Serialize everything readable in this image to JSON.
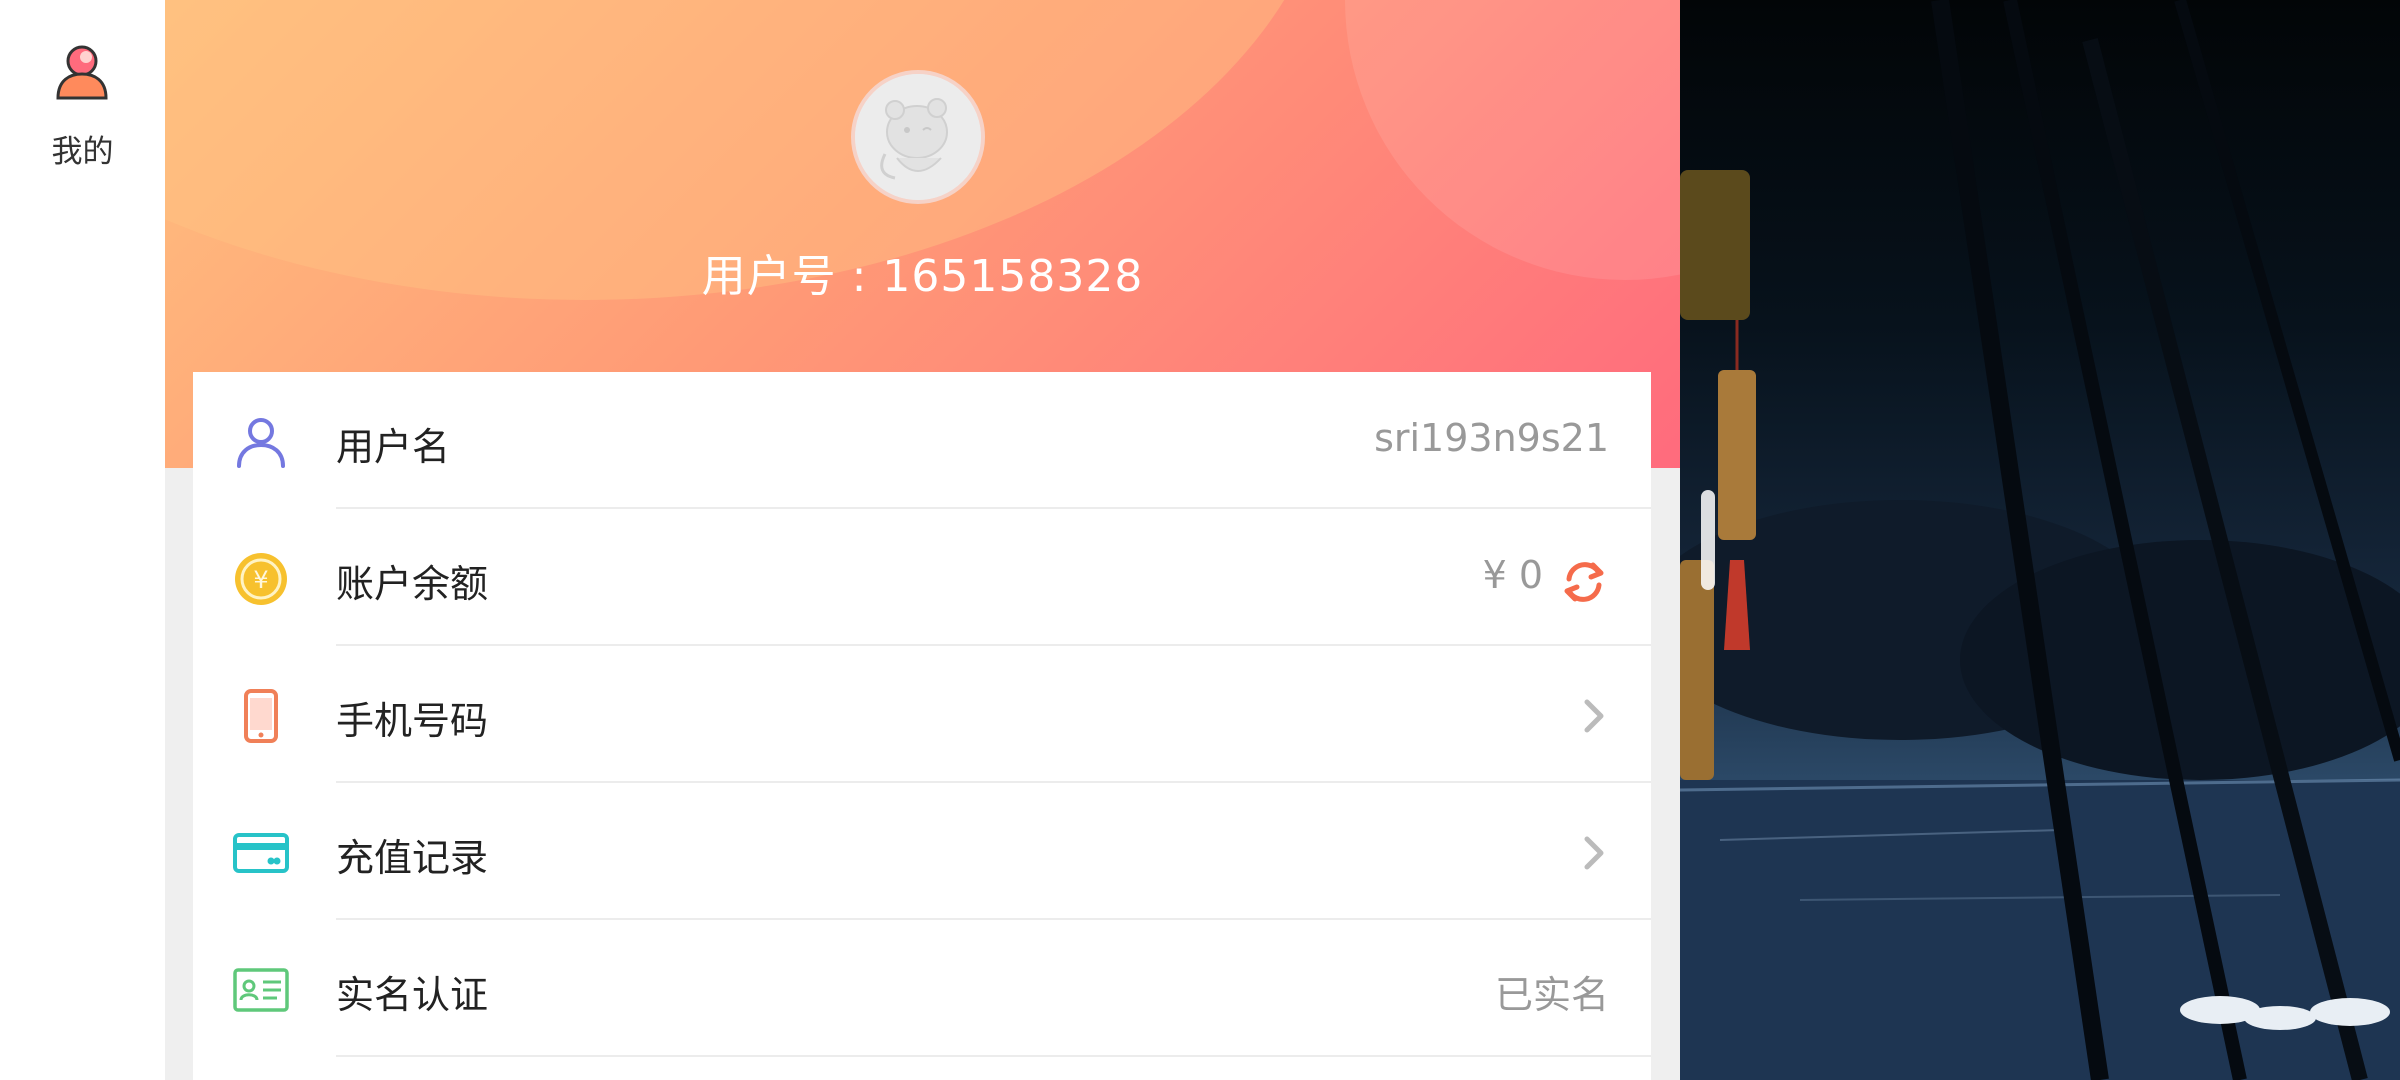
{
  "nav": {
    "items": [
      {
        "label": "我的",
        "icon": "user-icon",
        "active": true
      }
    ]
  },
  "header": {
    "user_id_text": "用户号 : 165158328",
    "avatar": "default-avatar"
  },
  "rows": [
    {
      "label": "用户名",
      "value": "sri193n9s21",
      "icon": "user-outline-icon"
    },
    {
      "label": "账户余额",
      "value": "¥ 0",
      "icon": "coin-icon",
      "action": "refresh-icon"
    },
    {
      "label": "手机号码",
      "value": "",
      "icon": "phone-icon",
      "action": "chevron-right-icon"
    },
    {
      "label": "充值记录",
      "value": "",
      "icon": "card-icon",
      "action": "chevron-right-icon"
    },
    {
      "label": "实名认证",
      "value": "已实名",
      "icon": "id-card-icon"
    }
  ],
  "colors": {
    "header_gradient_start": "#ffc07e",
    "header_gradient_end": "#ff6b7d",
    "refresh_accent": "#f56b4b",
    "chevron": "#bbbbbb"
  }
}
